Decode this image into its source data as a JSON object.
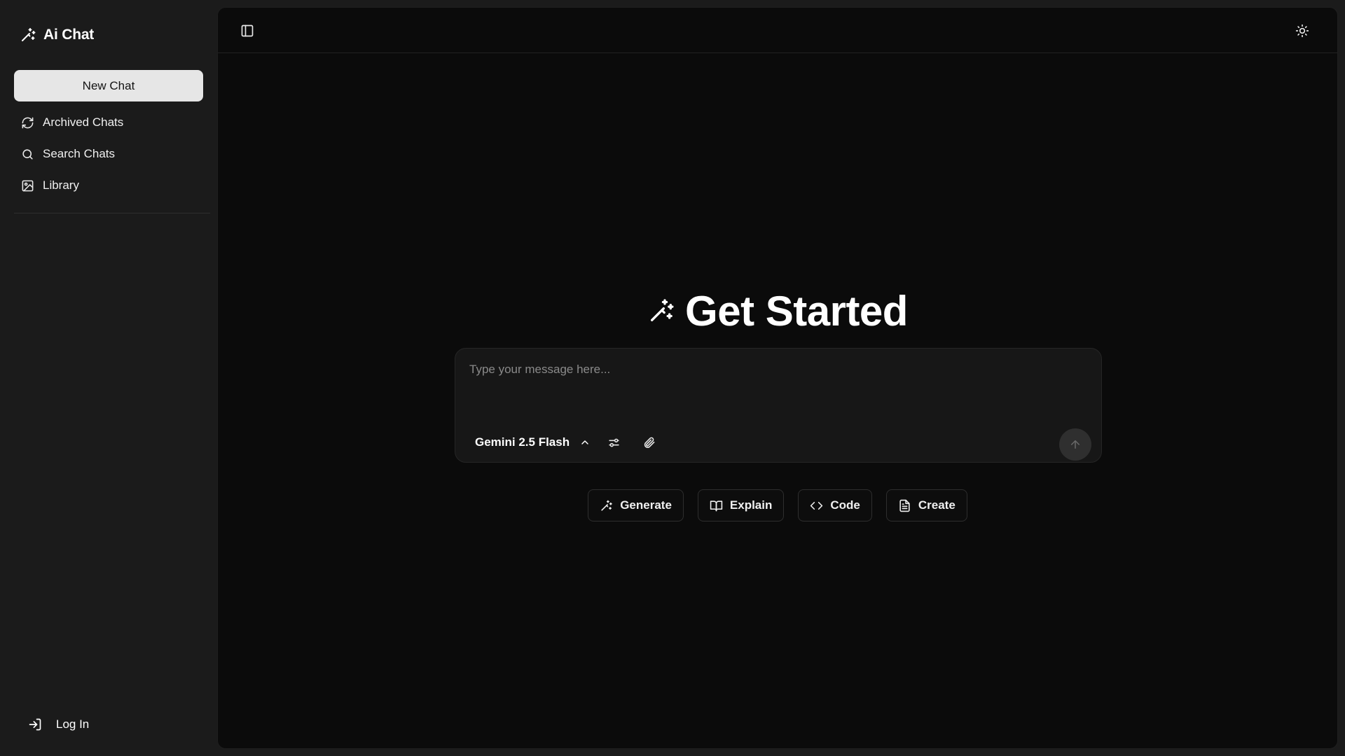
{
  "brand": {
    "title": "Ai Chat",
    "icon": "wand-sparkles-icon"
  },
  "sidebar": {
    "new_chat_label": "New Chat",
    "items": [
      {
        "label": "Archived Chats",
        "icon": "refresh-icon"
      },
      {
        "label": "Search Chats",
        "icon": "search-icon"
      },
      {
        "label": "Library",
        "icon": "image-icon"
      }
    ],
    "login_label": "Log In",
    "login_icon": "log-in-icon"
  },
  "topbar": {
    "toggle_sidebar_icon": "panel-left-icon",
    "theme_icon": "sun-icon"
  },
  "hero": {
    "title": "Get Started",
    "icon": "wand-sparkles-icon"
  },
  "composer": {
    "placeholder": "Type your message here...",
    "model": "Gemini 2.5 Flash",
    "model_icon": "chevron-up-icon",
    "options_icon": "sliders-icon",
    "attach_icon": "paperclip-icon",
    "send_icon": "arrow-up-icon"
  },
  "suggestions": [
    {
      "label": "Generate",
      "icon": "wand-sparkles-icon"
    },
    {
      "label": "Explain",
      "icon": "book-open-icon"
    },
    {
      "label": "Code",
      "icon": "code-icon"
    },
    {
      "label": "Create",
      "icon": "file-text-icon"
    }
  ],
  "colors": {
    "sidebar_bg": "#1b1b1b",
    "main_bg": "#0b0b0b",
    "composer_bg": "#171717",
    "button_light": "#e6e6e6",
    "text": "#f2f2f2",
    "placeholder": "#8a8a8a"
  }
}
